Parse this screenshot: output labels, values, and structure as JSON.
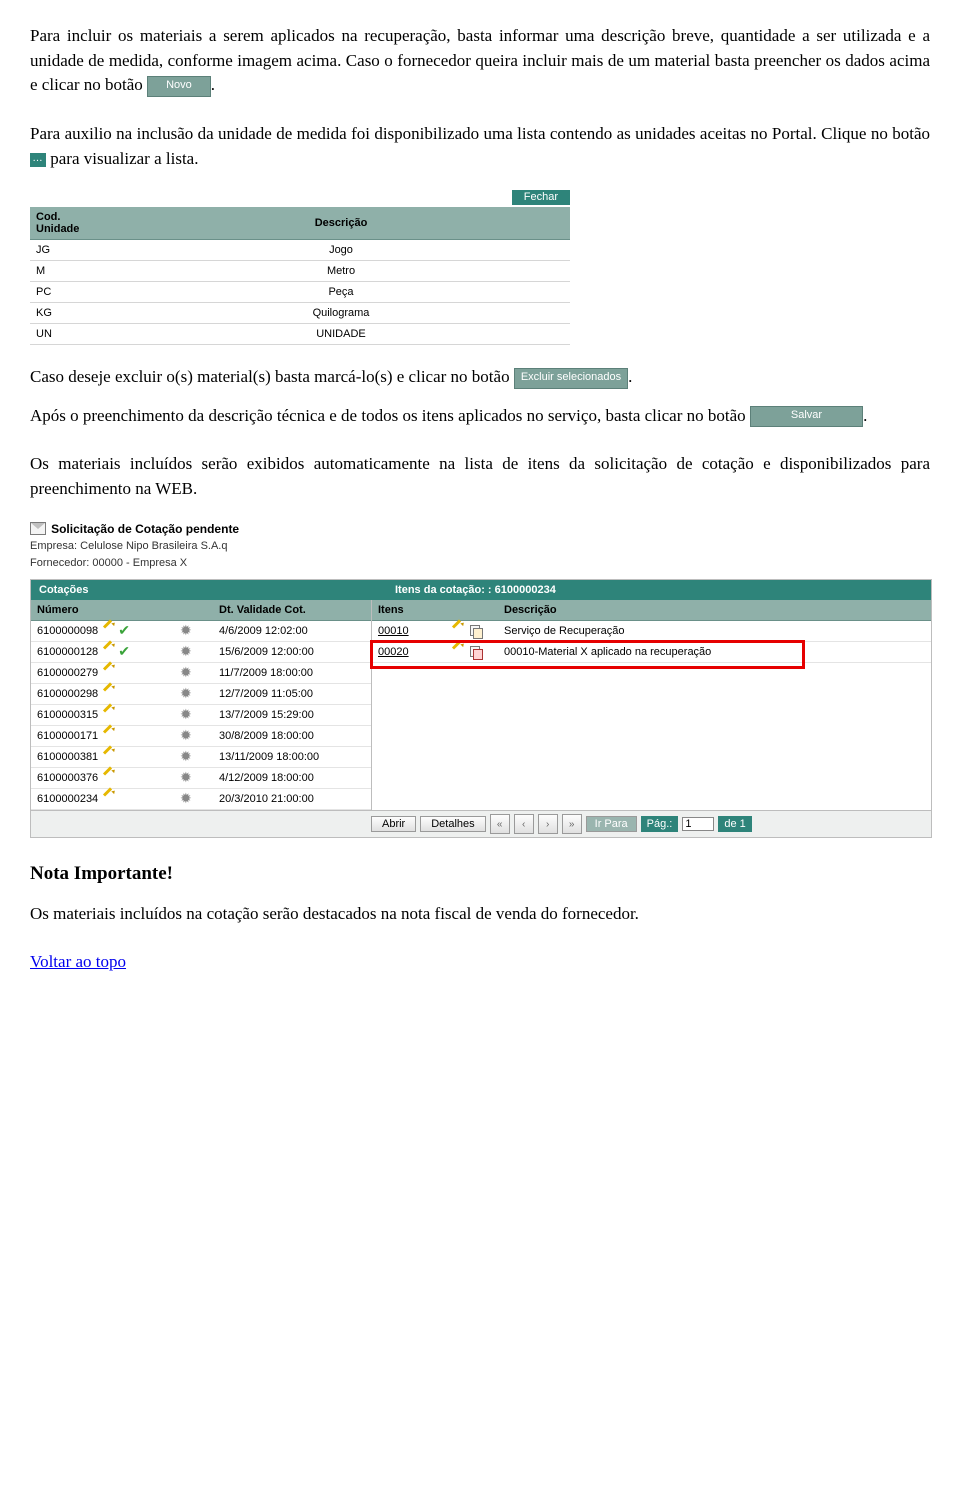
{
  "para1_a": "Para incluir os materiais a serem aplicados na recuperação, basta informar uma descrição breve, quantidade a ser utilizada e a unidade de medida, conforme imagem acima. Caso o fornecedor queira incluir mais de um material basta preencher os dados acima e clicar no botão ",
  "btn_novo": "Novo",
  "para1_b": ".",
  "para2_a": "Para auxilio na inclusão da unidade de medida foi disponibilizado uma lista contendo as unidades aceitas no Portal. Clique no botão ",
  "para2_b": " para visualizar a lista.",
  "fechar": "Fechar",
  "units_header_cod": "Cod. Unidade",
  "units_header_desc": "Descrição",
  "units": [
    {
      "cod": "JG",
      "desc": "Jogo"
    },
    {
      "cod": "M",
      "desc": "Metro"
    },
    {
      "cod": "PC",
      "desc": "Peça"
    },
    {
      "cod": "KG",
      "desc": "Quilograma"
    },
    {
      "cod": "UN",
      "desc": "UNIDADE"
    }
  ],
  "para3_a": "Caso deseje excluir o(s) material(s) basta marcá-lo(s) e clicar no botão ",
  "btn_excluir": "Excluir selecionados",
  "para3_b": ".",
  "para4_a": "Após o preenchimento da descrição técnica e de todos os itens aplicados no serviço, basta clicar no botão ",
  "btn_salvar": "Salvar",
  "para4_b": ".",
  "para5": "Os materiais incluídos serão exibidos automaticamente na lista de itens da solicitação de cotação e disponibilizados para preenchimento na WEB.",
  "cot_title": "Solicitação de Cotação pendente",
  "cot_empresa": "Empresa: Celulose Nipo Brasileira S.A.q",
  "cot_fornecedor": "Fornecedor: 00000 - Empresa X",
  "cot_bar_left": "Cotações",
  "cot_bar_right": "Itens da cotação:  : 6100000234",
  "cot_hdr_num": "Número",
  "cot_hdr_dt": "Dt. Validade Cot.",
  "cot_hdr_itens": "Itens",
  "cot_hdr_desc": "Descrição",
  "cot_rows": [
    {
      "num": "6100000098",
      "chk": true,
      "dt": "4/6/2009 12:02:00"
    },
    {
      "num": "6100000128",
      "chk": true,
      "dt": "15/6/2009 12:00:00"
    },
    {
      "num": "6100000279",
      "chk": false,
      "dt": "11/7/2009 18:00:00"
    },
    {
      "num": "6100000298",
      "chk": false,
      "dt": "12/7/2009 11:05:00"
    },
    {
      "num": "6100000315",
      "chk": false,
      "dt": "13/7/2009 15:29:00"
    },
    {
      "num": "6100000171",
      "chk": false,
      "dt": "30/8/2009 18:00:00"
    },
    {
      "num": "6100000381",
      "chk": false,
      "dt": "13/11/2009 18:00:00"
    },
    {
      "num": "6100000376",
      "chk": false,
      "dt": "4/12/2009 18:00:00"
    },
    {
      "num": "6100000234",
      "chk": false,
      "dt": "20/3/2010 21:00:00"
    }
  ],
  "item_rows": [
    {
      "id": "00010",
      "desc": "Serviço de Recuperação",
      "hl": false
    },
    {
      "id": "00020",
      "desc": "00010-Material X aplicado na recuperação",
      "hl": true
    }
  ],
  "footer": {
    "abrir": "Abrir",
    "detalhes": "Detalhes",
    "irpara": "Ir Para",
    "pag": "Pág.:",
    "pageval": "1",
    "de": "de 1"
  },
  "nota_title": "Nota Importante!",
  "nota_body": "Os materiais incluídos na cotação serão destacados na nota fiscal de venda do fornecedor.",
  "voltar": "Voltar ao topo"
}
